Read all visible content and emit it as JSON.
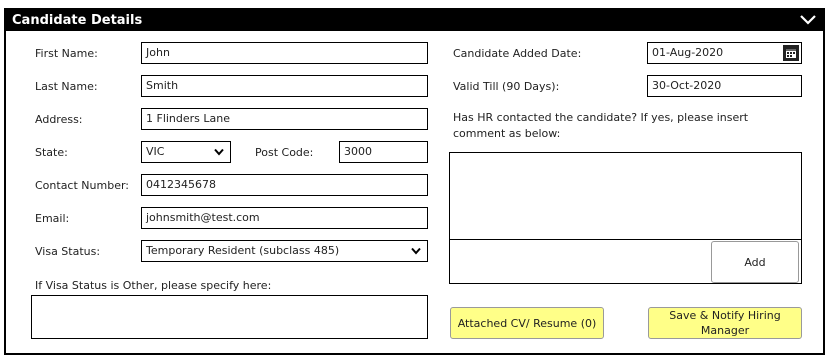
{
  "panel": {
    "title": "Candidate Details"
  },
  "form": {
    "first_name_label": "First Name:",
    "first_name_value": "John",
    "last_name_label": "Last Name:",
    "last_name_value": "Smith",
    "address_label": "Address:",
    "address_value": "1 Flinders Lane",
    "state_label": "State:",
    "state_value": "VIC",
    "postcode_label": "Post Code:",
    "postcode_value": "3000",
    "contact_label": "Contact Number:",
    "contact_value": "0412345678",
    "email_label": "Email:",
    "email_value": "johnsmith@test.com",
    "visa_label": "Visa Status:",
    "visa_value": "Temporary Resident (subclass 485)",
    "visa_other_label": "If Visa Status is Other, please specify here:",
    "visa_other_value": ""
  },
  "right": {
    "added_date_label": "Candidate Added Date:",
    "added_date_value": "01-Aug-2020",
    "valid_till_label": "Valid Till (90 Days):",
    "valid_till_value": "30-Oct-2020",
    "hr_question": "Has HR contacted the candidate? If yes, please insert comment as below:",
    "comment_value": "",
    "add_label": "Add",
    "attached_cv_label": "Attached CV/ Resume (0)",
    "save_notify_label": "Save & Notify Hiring Manager"
  },
  "icons": {
    "collapse": "chevron-down-icon",
    "calendar": "calendar-icon",
    "dropdown": "dropdown-arrow-icon"
  }
}
